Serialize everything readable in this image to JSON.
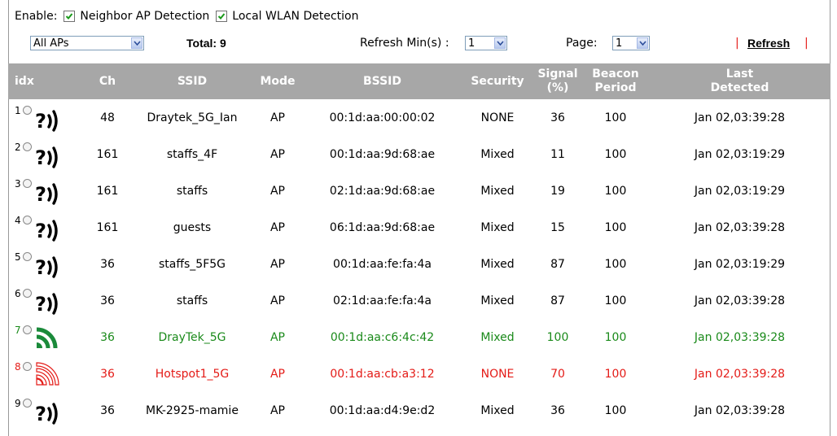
{
  "enable": {
    "label": "Enable:",
    "neighbor_ap_label": "Neighbor AP Detection",
    "local_wlan_label": "Local WLAN Detection"
  },
  "controls": {
    "filter_value": "All APs",
    "total_label": "Total: 9",
    "refresh_min_label": "Refresh Min(s) :",
    "refresh_min_value": "1",
    "page_label": "Page:",
    "page_value": "1",
    "refresh_sep_left": "|",
    "refresh_link": "Refresh",
    "refresh_sep_right": "|"
  },
  "colors": {
    "header_bg": "#a7a7a7",
    "green": "#1a8a1a",
    "red": "#e41b17"
  },
  "table": {
    "headers": {
      "idx": "idx",
      "ch": "Ch",
      "ssid": "SSID",
      "mode": "Mode",
      "bssid": "BSSID",
      "security": "Security",
      "signal_1": "Signal",
      "signal_2": "(%)",
      "beacon_1": "Beacon",
      "beacon_2": "Period",
      "last_1": "Last",
      "last_2": "Detected"
    },
    "rows": [
      {
        "idx": "1",
        "icon": "unknown-ap-icon",
        "ch": "48",
        "ssid": "Draytek_5G_Ian",
        "mode": "AP",
        "bssid": "00:1d:aa:00:00:02",
        "security": "NONE",
        "signal": "36",
        "beacon": "100",
        "last": "Jan 02,03:39:28"
      },
      {
        "idx": "2",
        "icon": "unknown-ap-icon",
        "ch": "161",
        "ssid": "staffs_4F",
        "mode": "AP",
        "bssid": "00:1d:aa:9d:68:ae",
        "security": "Mixed",
        "signal": "11",
        "beacon": "100",
        "last": "Jan 02,03:19:29"
      },
      {
        "idx": "3",
        "icon": "unknown-ap-icon",
        "ch": "161",
        "ssid": "staffs",
        "mode": "AP",
        "bssid": "02:1d:aa:9d:68:ae",
        "security": "Mixed",
        "signal": "19",
        "beacon": "100",
        "last": "Jan 02,03:19:29"
      },
      {
        "idx": "4",
        "icon": "unknown-ap-icon",
        "ch": "161",
        "ssid": "guests",
        "mode": "AP",
        "bssid": "06:1d:aa:9d:68:ae",
        "security": "Mixed",
        "signal": "15",
        "beacon": "100",
        "last": "Jan 02,03:39:28"
      },
      {
        "idx": "5",
        "icon": "unknown-ap-icon",
        "ch": "36",
        "ssid": "staffs_5F5G",
        "mode": "AP",
        "bssid": "00:1d:aa:fe:fa:4a",
        "security": "Mixed",
        "signal": "87",
        "beacon": "100",
        "last": "Jan 02,03:19:29"
      },
      {
        "idx": "6",
        "icon": "unknown-ap-icon",
        "ch": "36",
        "ssid": "staffs",
        "mode": "AP",
        "bssid": "02:1d:aa:fe:fa:4a",
        "security": "Mixed",
        "signal": "87",
        "beacon": "100",
        "last": "Jan 02,03:39:28"
      },
      {
        "idx": "7",
        "icon": "trusted-ap-icon",
        "ch": "36",
        "ssid": "DrayTek_5G",
        "mode": "AP",
        "bssid": "00:1d:aa:c6:4c:42",
        "security": "Mixed",
        "signal": "100",
        "beacon": "100",
        "last": "Jan 02,03:39:28",
        "style": "green"
      },
      {
        "idx": "8",
        "icon": "rogue-ap-icon",
        "ch": "36",
        "ssid": "Hotspot1_5G",
        "mode": "AP",
        "bssid": "00:1d:aa:cb:a3:12",
        "security": "NONE",
        "signal": "70",
        "beacon": "100",
        "last": "Jan 02,03:39:28",
        "style": "red"
      },
      {
        "idx": "9",
        "icon": "unknown-ap-icon",
        "ch": "36",
        "ssid": "MK-2925-mamie",
        "mode": "AP",
        "bssid": "00:1d:aa:d4:9e:d2",
        "security": "Mixed",
        "signal": "36",
        "beacon": "100",
        "last": "Jan 02,03:39:28"
      }
    ]
  }
}
